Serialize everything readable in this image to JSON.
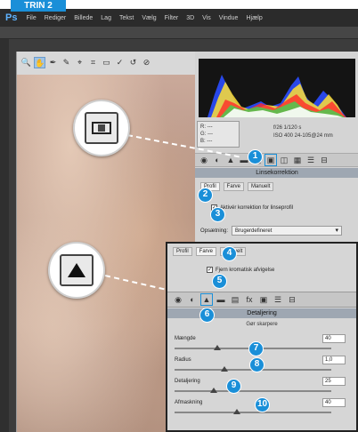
{
  "tab_label": "TRIN 2",
  "menubar": {
    "logo": "Ps",
    "items": [
      "File",
      "Rediger",
      "Billede",
      "Lag",
      "Tekst",
      "Vælg",
      "Filter",
      "3D",
      "Vis",
      "Vindue",
      "Hjælp"
    ]
  },
  "tools": [
    "🔍",
    "✋",
    "✒",
    "✎",
    "⌖",
    "⌗",
    "▭",
    "✓",
    "↺",
    "⊘"
  ],
  "info": {
    "rgb_labels": [
      "R:",
      "G:",
      "B:"
    ],
    "rgb_values": [
      "---",
      "---",
      "---"
    ],
    "line1": "f/26   1/120 s",
    "line2": "ISO 400   24-105@24 mm"
  },
  "panel": {
    "icons": [
      "◉",
      "◐",
      "▲",
      "▬",
      "▤",
      "▣",
      "◫",
      "▦",
      "☰",
      "⊟"
    ],
    "title": "Linsekorrektion",
    "sub_tabs": [
      "Profil",
      "Farve",
      "Manuelt"
    ],
    "checkbox_label": "Aktivér korrektion for linseprofil",
    "dropdown_label": "Opsætning:",
    "dropdown_value": "Brugerdefineret"
  },
  "overlay": {
    "tabs": [
      "Profil",
      "Farve",
      "Manuelt"
    ],
    "checkbox_label": "Fjern kromatisk afvigelse",
    "icons": [
      "◉",
      "◐",
      "▲",
      "▬",
      "▤",
      "fx",
      "▣",
      "☰",
      "⊟"
    ],
    "title": "Detaljering",
    "subtitle": "Gør skarpere",
    "sliders": [
      {
        "label": "Mængde",
        "value": "40",
        "fraction": 0.27
      },
      {
        "label": "Radius",
        "value": "1,0",
        "fraction": 0.32
      },
      {
        "label": "Detaljering",
        "value": "25",
        "fraction": 0.25
      },
      {
        "label": "Afmaskning",
        "value": "40",
        "fraction": 0.4
      }
    ]
  },
  "badges": [
    "1",
    "2",
    "3",
    "4",
    "5",
    "6",
    "7",
    "8",
    "9",
    "10"
  ],
  "colors": {
    "accent": "#1a8fd8",
    "panel_title": "#9ea7b2"
  }
}
